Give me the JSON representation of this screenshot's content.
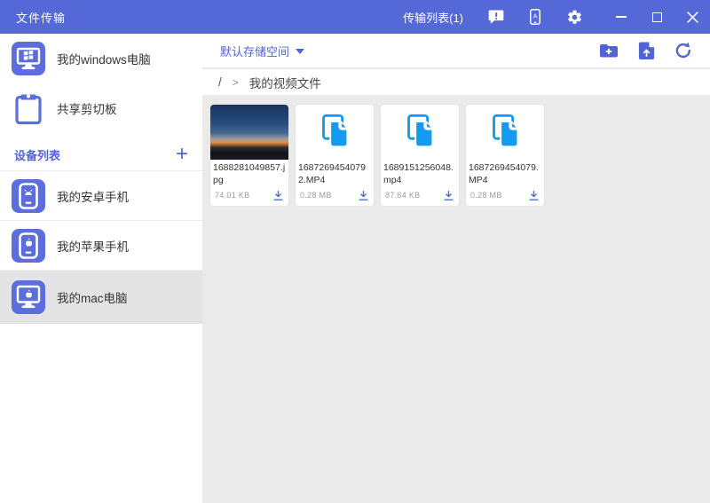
{
  "titlebar": {
    "title": "文件传输",
    "transfer_list_label": "传输列表(1)",
    "icons": {
      "feedback": "feedback-message-icon",
      "device_glyph": "A",
      "settings": "settings-gear-icon"
    }
  },
  "sidebar": {
    "top_items": [
      {
        "label": "我的windows电脑",
        "icon": "windows-computer-icon"
      },
      {
        "label": "共享剪切板",
        "icon": "clipboard-icon"
      }
    ],
    "device_list": {
      "header": "设备列表",
      "add_label": "+",
      "devices": [
        {
          "label": "我的安卓手机",
          "icon": "android-phone-icon",
          "selected": false
        },
        {
          "label": "我的苹果手机",
          "icon": "apple-phone-icon",
          "selected": false
        },
        {
          "label": "我的mac电脑",
          "icon": "mac-computer-icon",
          "selected": true
        }
      ]
    }
  },
  "toolbar": {
    "storage_selector": "默认存储空间",
    "icons": [
      "new-folder-icon",
      "upload-file-icon",
      "refresh-icon"
    ]
  },
  "breadcrumb": {
    "root": "/",
    "separator": ">",
    "current": "我的视频文件"
  },
  "files": [
    {
      "name": "1688281049857.jpg",
      "size": "74.01 KB",
      "type": "image"
    },
    {
      "name": "16872694540792.MP4",
      "size": "0.28 MB",
      "type": "video"
    },
    {
      "name": "1689151256048.mp4",
      "size": "87.64 KB",
      "type": "video"
    },
    {
      "name": "1687269454079.MP4",
      "size": "0.28 MB",
      "type": "video"
    }
  ],
  "colors": {
    "titlebar_blue": "#5468d8",
    "accent_blue": "#5064d2",
    "file_icon_blue": "#129bf0",
    "content_bg": "#eaeaea",
    "selected_bg": "#e4e4e4"
  }
}
